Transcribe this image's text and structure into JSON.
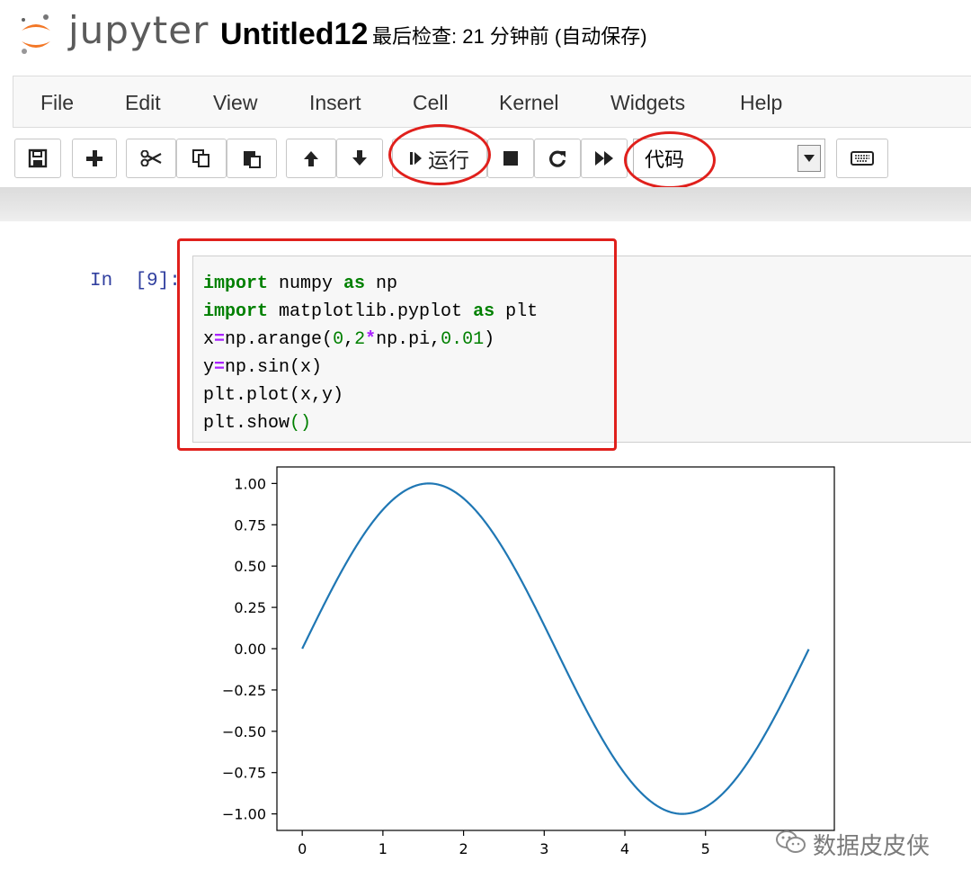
{
  "header": {
    "logo_text": "jupyter",
    "notebook_title": "Untitled12",
    "checkpoint_text": "最后检查: 21 分钟前  (自动保存)"
  },
  "menubar": {
    "items": [
      "File",
      "Edit",
      "View",
      "Insert",
      "Cell",
      "Kernel",
      "Widgets",
      "Help"
    ]
  },
  "toolbar": {
    "icons": [
      "save-icon",
      "plus-icon",
      "cut-icon",
      "copy-icon",
      "paste-icon",
      "arrow-up-icon",
      "arrow-down-icon",
      "step-run-icon",
      "stop-icon",
      "restart-icon",
      "fast-forward-icon",
      "keyboard-icon"
    ],
    "run_label": "运行",
    "cell_type_selected": "代码"
  },
  "cell": {
    "prompt": "In  [9]:",
    "code_lines": [
      "import numpy as np",
      "import matplotlib.pyplot as plt",
      "x=np.arange(0,2*np.pi,0.01)",
      "y=np.sin(x)",
      "plt.plot(x,y)",
      "plt.show()"
    ]
  },
  "annotation_color": "#e0201c",
  "chart_data": {
    "type": "line",
    "series": [
      {
        "function": "sin(x)",
        "x_start": 0,
        "x_end": 6.28,
        "x_step": 0.01,
        "color": "#1f77b4"
      }
    ],
    "x_ticks": [
      "0",
      "1",
      "2",
      "3",
      "4",
      "5"
    ],
    "y_ticks": [
      "1.00",
      "0.75",
      "0.50",
      "0.25",
      "0.00",
      "−0.25",
      "−0.50",
      "−0.75",
      "−1.00"
    ],
    "xlim": [
      -0.314,
      6.597
    ],
    "ylim": [
      -1.1,
      1.1
    ],
    "title": "",
    "xlabel": "",
    "ylabel": "",
    "grid": false,
    "legend": "none"
  },
  "watermark": {
    "icon": "wechat-icon",
    "text": "数据皮皮侠"
  }
}
